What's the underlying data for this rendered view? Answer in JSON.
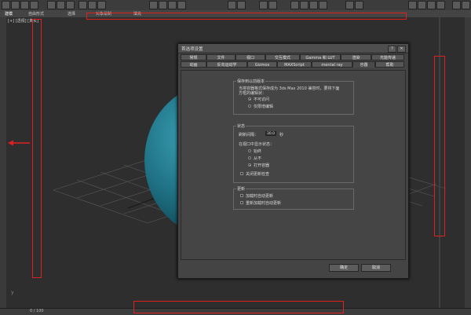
{
  "ribbon": {
    "tabs": [
      "建模",
      "自由形式",
      "选择",
      "对象绘制",
      "填充"
    ]
  },
  "viewport": {
    "label": "[+] [透视] [真实]",
    "timeline": "0 / 100"
  },
  "dialog": {
    "title": "首选项设置",
    "help_btn": "?",
    "close_btn": "×",
    "tabs_row1": [
      "常规",
      "文件",
      "视口",
      "交互模式",
      "Gamma 和 LUT",
      "渲染",
      "光能传递"
    ],
    "tabs_row2": [
      "动画",
      "反向运动学",
      "Gizmos",
      "MAXScript",
      "mental ray",
      "容器",
      "帮助"
    ],
    "active_tab": "容器",
    "save_group": {
      "label": "保存到以前版本",
      "desc_line1": "当将容器格式保存成为 3ds Max 2010 兼容时，要将下面",
      "desc_line2": "方框的编辑状：",
      "opt1": "不可访问",
      "opt2": "仅限增编辑"
    },
    "status_group": {
      "label": "状态",
      "refresh_label": "刷新间隔：",
      "refresh_value": "30.0",
      "refresh_unit": "秒",
      "display_label": "在视口中显示状态：",
      "opt1": "始终",
      "opt2": "从不",
      "opt3": "打开容器",
      "checkbox": "关闭更新检查"
    },
    "update_group": {
      "label": "更新",
      "cb1": "加载时自动更新",
      "cb2": "重新加载时自动更新"
    },
    "ok": "确定",
    "cancel": "取消"
  }
}
